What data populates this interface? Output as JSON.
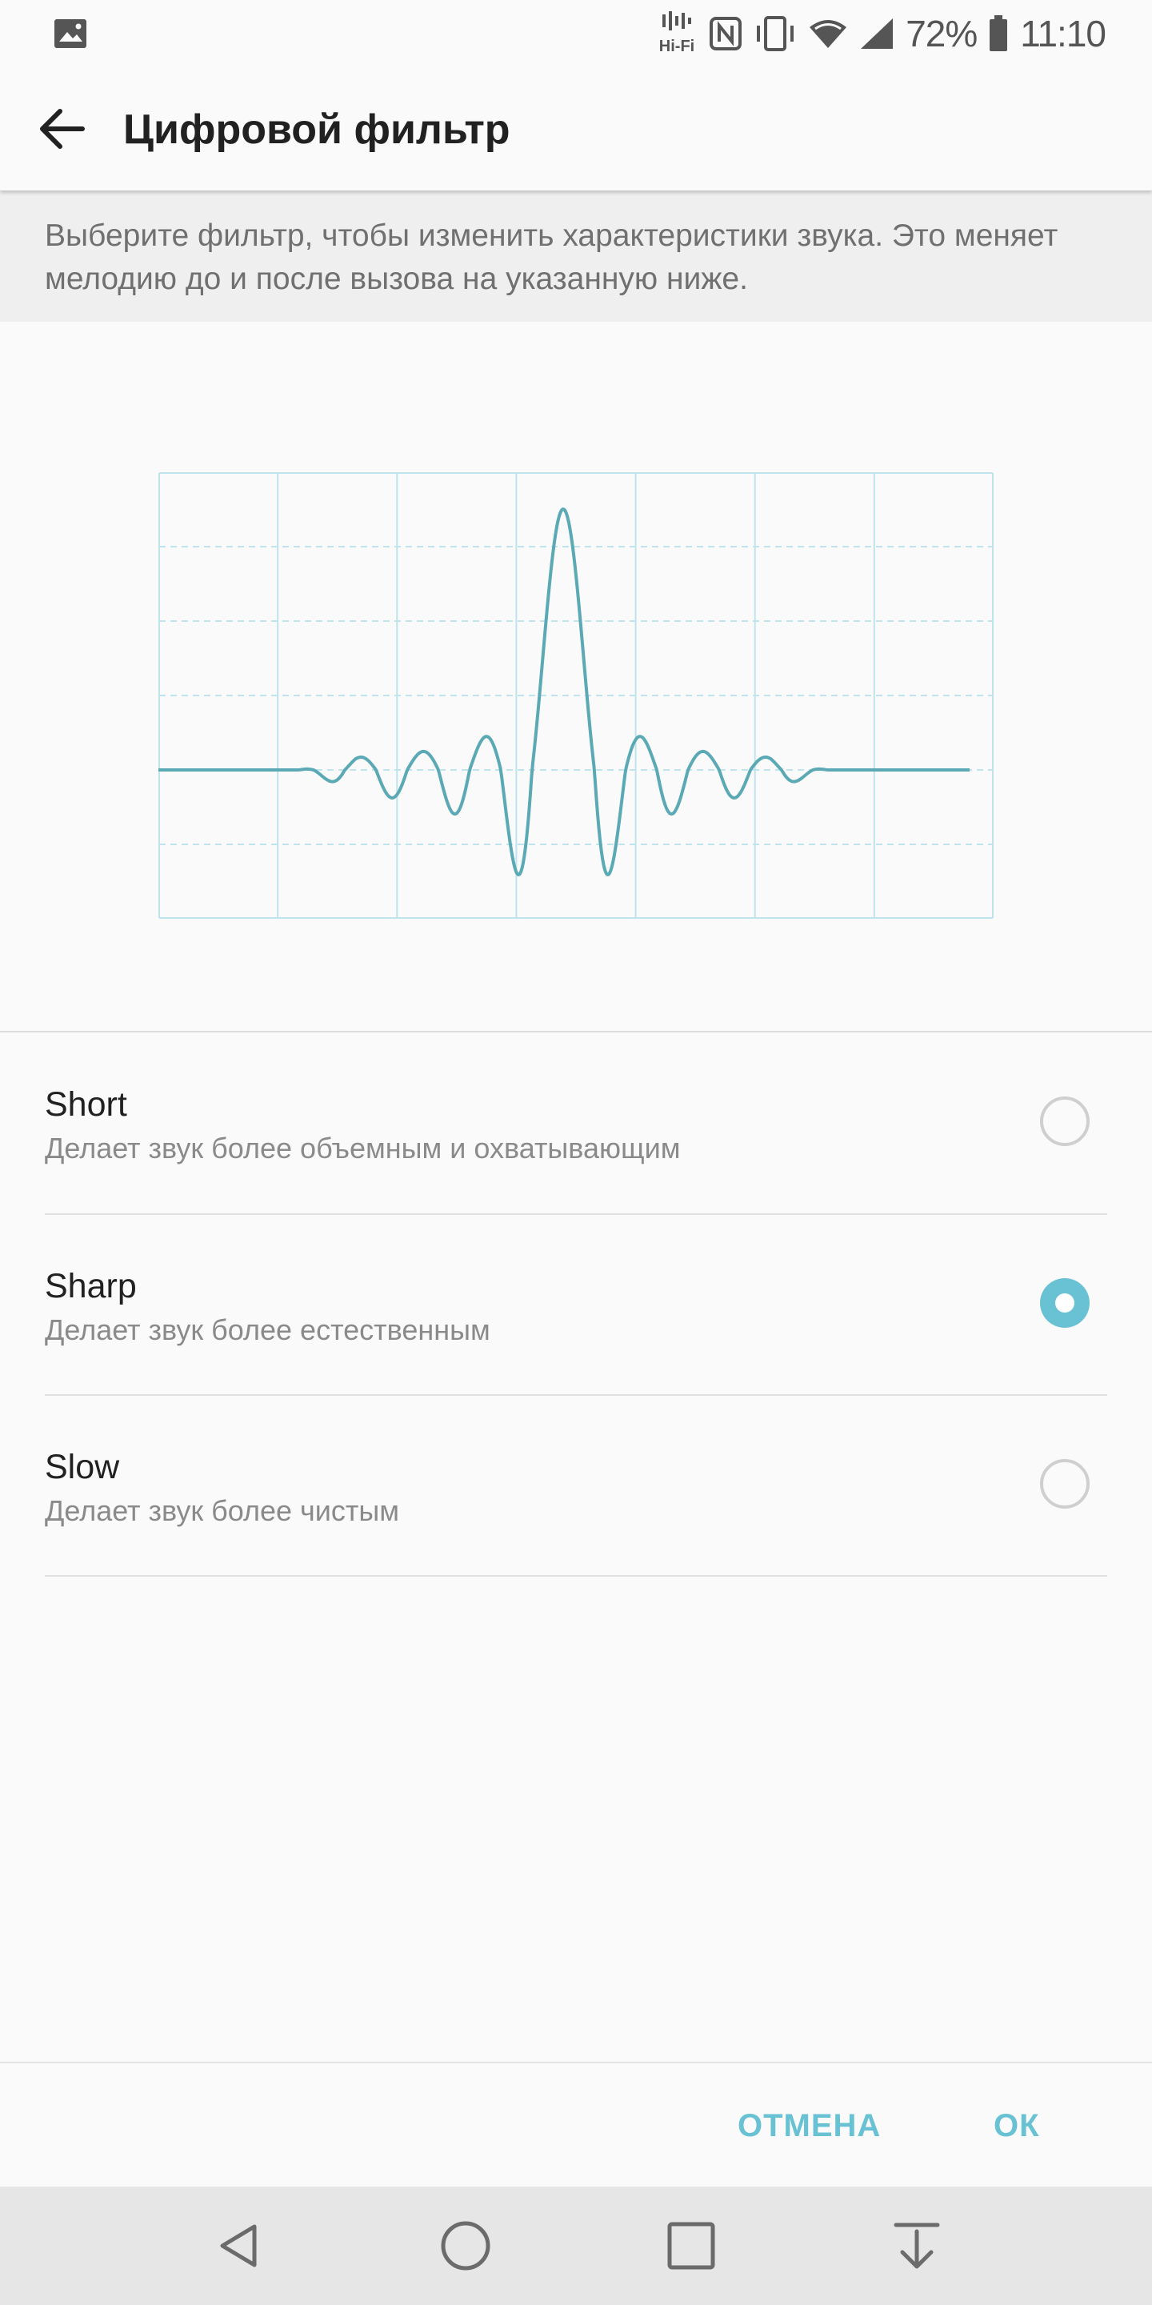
{
  "status_bar": {
    "hifi_label": "Hi-Fi",
    "battery": "72%",
    "time": "11:10",
    "icons": [
      "image-icon",
      "hifi-icon",
      "nfc-icon",
      "vibrate-icon",
      "wifi-icon",
      "signal-icon",
      "battery-icon"
    ]
  },
  "header": {
    "title": "Цифровой фильтр",
    "back_icon": "arrow-back-icon"
  },
  "description": "Выберите фильтр, чтобы изменить характеристики звука. Это меняет мелодию до и после вызова на указанную ниже.",
  "colors": {
    "accent": "#69c1d4",
    "wave": "#5aa9b5",
    "grid": "#bfe4ee"
  },
  "options": [
    {
      "title": "Short",
      "subtitle": "Делает звук более объемным и охватывающим",
      "selected": false
    },
    {
      "title": "Sharp",
      "subtitle": "Делает звук более естественным",
      "selected": true
    },
    {
      "title": "Slow",
      "subtitle": "Делает звук более чистым",
      "selected": false
    }
  ],
  "buttons": {
    "cancel": "ОТМЕНА",
    "ok": "ОК"
  },
  "nav": {
    "icons": [
      "back-triangle-icon",
      "home-circle-icon",
      "recents-square-icon",
      "notifications-down-icon"
    ]
  }
}
